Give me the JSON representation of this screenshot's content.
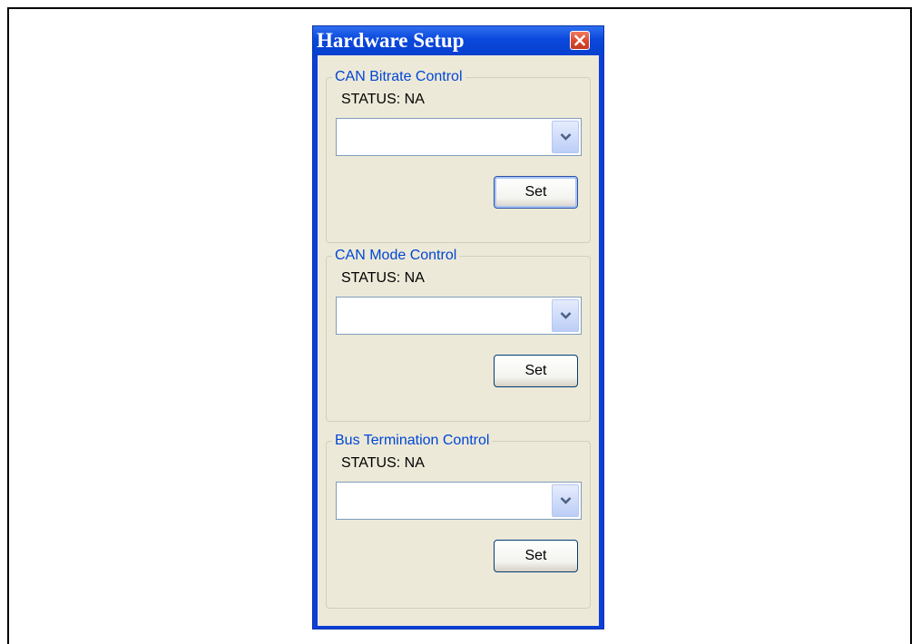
{
  "window": {
    "title": "Hardware Setup"
  },
  "groups": [
    {
      "legend": "CAN Bitrate Control",
      "status": "STATUS: NA",
      "combo_value": "",
      "button": "Set"
    },
    {
      "legend": "CAN Mode Control",
      "status": "STATUS: NA",
      "combo_value": "",
      "button": "Set"
    },
    {
      "legend": "Bus Termination Control",
      "status": "STATUS: NA",
      "combo_value": "",
      "button": "Set"
    }
  ],
  "icons": {
    "close": "close-icon",
    "dropdown": "chevron-down-icon"
  },
  "colors": {
    "titlebar": "#0a48dc",
    "client_bg": "#ece9d8",
    "legend_text": "#0046d5",
    "close_button": "#d8452a"
  }
}
